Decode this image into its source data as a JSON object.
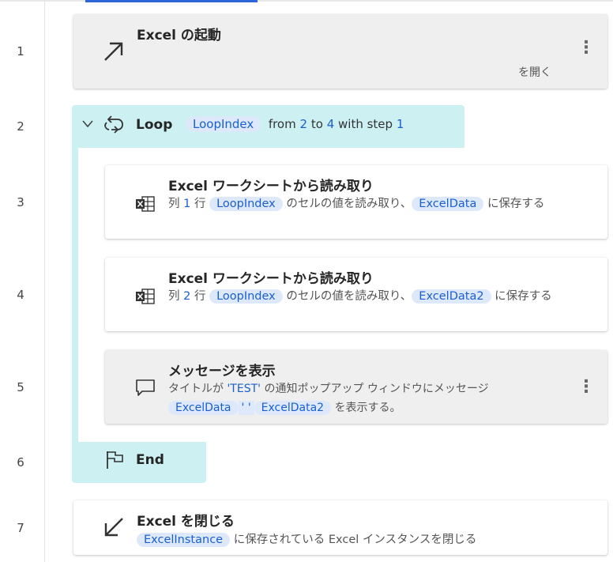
{
  "line_numbers": [
    "1",
    "2",
    "3",
    "4",
    "5",
    "6",
    "7"
  ],
  "step1": {
    "title": "Excel の起動",
    "desc": "を開く",
    "icon": "arrow-up-right-icon"
  },
  "loop": {
    "title": "Loop",
    "var": "LoopIndex",
    "from_label": "from",
    "from_value": "2",
    "to_label": "to",
    "to_value": "4",
    "step_label": "with step",
    "step_value": "1"
  },
  "step3": {
    "title": "Excel ワークシートから読み取り",
    "p1": "列",
    "col": "1",
    "p2": "行",
    "row_var": "LoopIndex",
    "p3": "のセルの値を読み取り、",
    "out_var": "ExcelData",
    "p4": "に保存する"
  },
  "step4": {
    "title": "Excel ワークシートから読み取り",
    "p1": "列",
    "col": "2",
    "p2": "行",
    "row_var": "LoopIndex",
    "p3": "のセルの値を読み取り、",
    "out_var": "ExcelData2",
    "p4": "に保存する"
  },
  "step5": {
    "title": "メッセージを表示",
    "p1": "タイトルが",
    "title_val": "'TEST'",
    "p2": "の通知ポップアップ ウィンドウにメッセージ",
    "var1": "ExcelData",
    "sep": "' '",
    "var2": "ExcelData2",
    "p3": "を表示する。"
  },
  "end": {
    "label": "End"
  },
  "step7": {
    "title": "Excel を閉じる",
    "var": "ExcelInstance",
    "desc": "に保存されている Excel インスタンスを閉じる"
  },
  "menu_glyph": "⋮",
  "colors": {
    "accent": "#1a5fd0",
    "loop_bg": "#cdf1f3",
    "token_bg": "#dde9fb"
  }
}
